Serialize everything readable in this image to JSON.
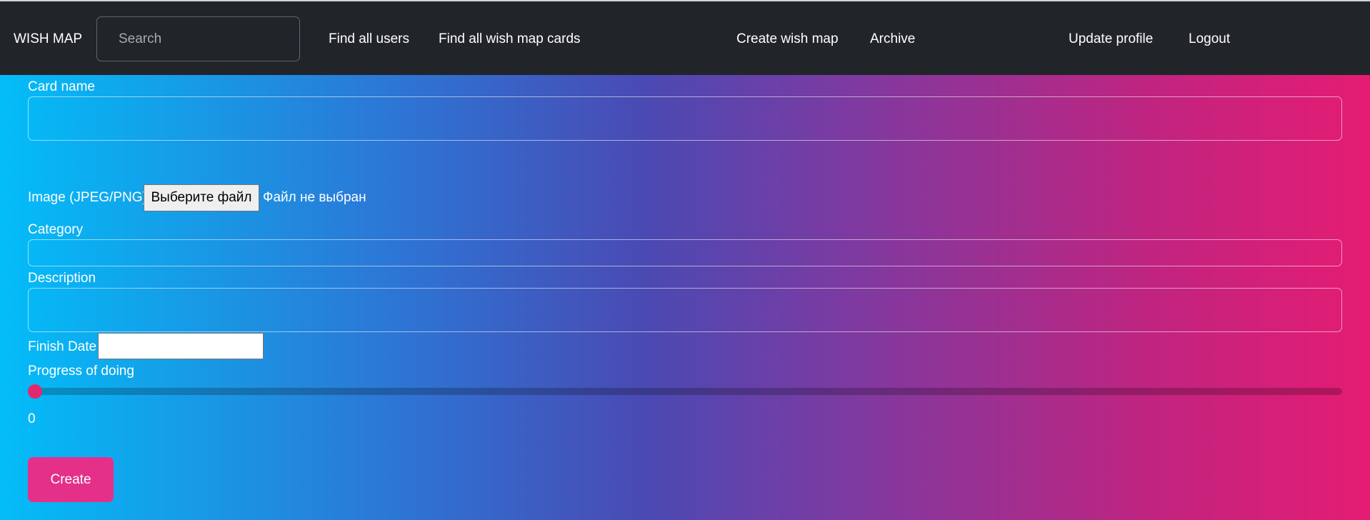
{
  "navbar": {
    "brand": "WISH MAP",
    "search_placeholder": "Search",
    "links": {
      "find_all_users": "Find all users",
      "find_all_cards": "Find all wish map cards",
      "create_wish_map": "Create wish map",
      "archive": "Archive",
      "update_profile": "Update profile",
      "logout": "Logout"
    }
  },
  "form": {
    "card_name_label": "Card name",
    "card_name_value": "",
    "image_label": "Image (JPEG/PNG)",
    "file_button_label": "Выберите файл",
    "file_status": "Файл не выбран",
    "category_label": "Category",
    "category_value": "",
    "description_label": "Description",
    "description_value": "",
    "finish_date_label": "Finish Date",
    "finish_date_value": "",
    "progress_label": "Progress of doing",
    "progress_value": 0,
    "progress_max": 100,
    "submit_label": "Create"
  },
  "colors": {
    "navbar_bg": "#212529",
    "gradient_start": "#03bdf8",
    "gradient_end": "#e51c73",
    "accent": "#e5308a"
  }
}
